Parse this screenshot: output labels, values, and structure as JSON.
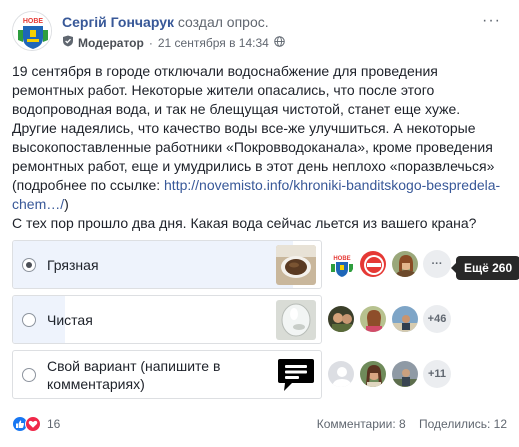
{
  "post": {
    "author": "Сергій Гончарук",
    "action": "создал опрос.",
    "role": "Модератор",
    "date": "21 сентября в 14:34",
    "more": "···"
  },
  "body": {
    "paragraph1": "19 сентября в городе отключали водоснабжение для проведения ремонтных работ. Некоторые жители опасались, что после этого водопроводная вода, и так не блещущая чистотой, станет еще хуже. Другие надеялись, что качество воды все-же улучшиться. А некоторые высокопоставленные работники «Покровводоканала», кроме проведения ремонтных работ, еще и умудрились в этот день неплохо «поразвлечься» (подробнее по ссылке: ",
    "link": "http://novemisto.info/khroniki-banditskogo-bespredela-chem…/",
    "paragraph1_end": ")",
    "paragraph2": "С тех пор прошло два дня. Какая вода сейчас льется из вашего крана?"
  },
  "poll": {
    "options": [
      {
        "label": "Грязная",
        "selected": true,
        "fill_percent": 91,
        "voters_more": "···",
        "thumb": "muddy-water-cup"
      },
      {
        "label": "Чистая",
        "selected": false,
        "fill_percent": 17,
        "voters_more": "+46",
        "thumb": "clean-water-glass"
      },
      {
        "label": "Свой вариант (напишите в комментариях)",
        "selected": false,
        "fill_percent": 0,
        "voters_more": "+11",
        "thumb": "comment-bubble"
      }
    ],
    "tooltip": "Ещё 260"
  },
  "footer": {
    "reactions_count": "16",
    "comments": "Комментарии: 8",
    "shares": "Поделились: 12"
  },
  "colors": {
    "link": "#385898",
    "like": "#1877f2",
    "angry": "#f02849",
    "poll_fill": "#eef3fc",
    "tooltip_bg": "#282828"
  },
  "icons": [
    "shield-icon",
    "globe-icon",
    "more-icon",
    "like-icon",
    "angry-icon",
    "comment-icon"
  ]
}
